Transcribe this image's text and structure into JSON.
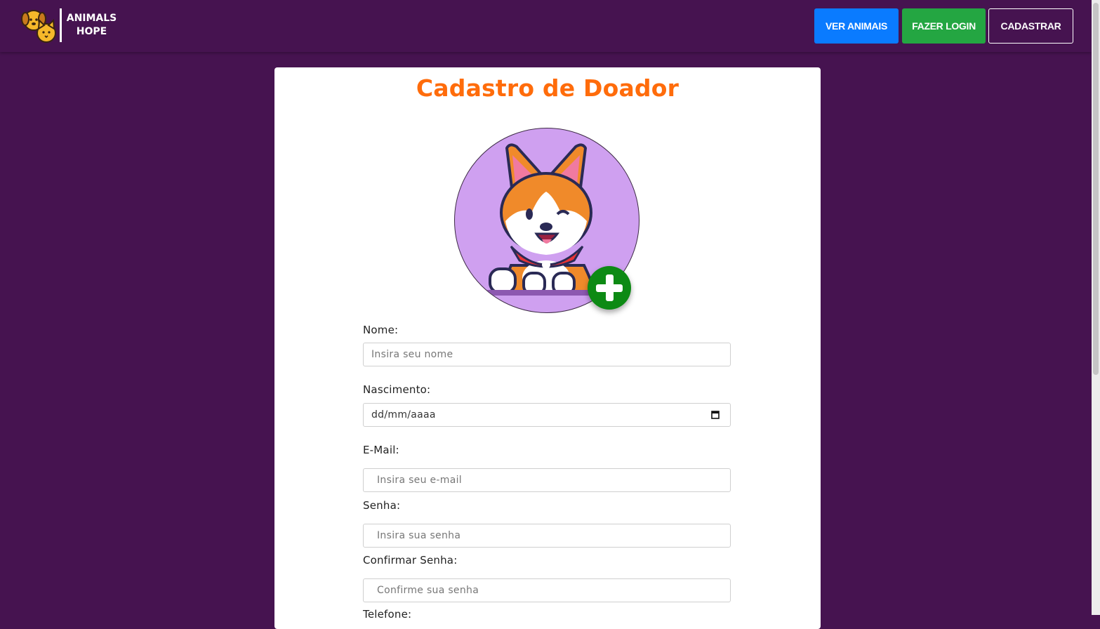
{
  "brand": {
    "line1": "ANIMALS",
    "line2": "HOPE"
  },
  "nav": {
    "ver_animais": "VER ANIMAIS",
    "fazer_login": "FAZER LOGIN",
    "cadastrar": "CADASTRAR"
  },
  "form": {
    "title": "Cadastro de Doador",
    "nome": {
      "label": "Nome:",
      "placeholder": "Insira seu nome"
    },
    "nascimento": {
      "label": "Nascimento:",
      "placeholder": "dd/mm/aaaa"
    },
    "email": {
      "label": "E-Mail:",
      "placeholder": "Insira seu e-mail"
    },
    "senha": {
      "label": "Senha:",
      "placeholder": "Insira sua senha"
    },
    "confirmar": {
      "label": "Confirmar Senha:",
      "placeholder": "Confirme sua senha"
    },
    "telefone": {
      "label": "Telefone:"
    }
  },
  "colors": {
    "background": "#461350",
    "title": "#ff6c0b",
    "ver_animais": "#0a7bff",
    "fazer_login": "#24a642",
    "add_photo": "#0d8a14"
  },
  "icons": {
    "logo": "dog-cat-logo-icon",
    "avatar": "corgi-avatar-icon",
    "add_photo": "plus-icon",
    "calendar": "calendar-icon"
  }
}
